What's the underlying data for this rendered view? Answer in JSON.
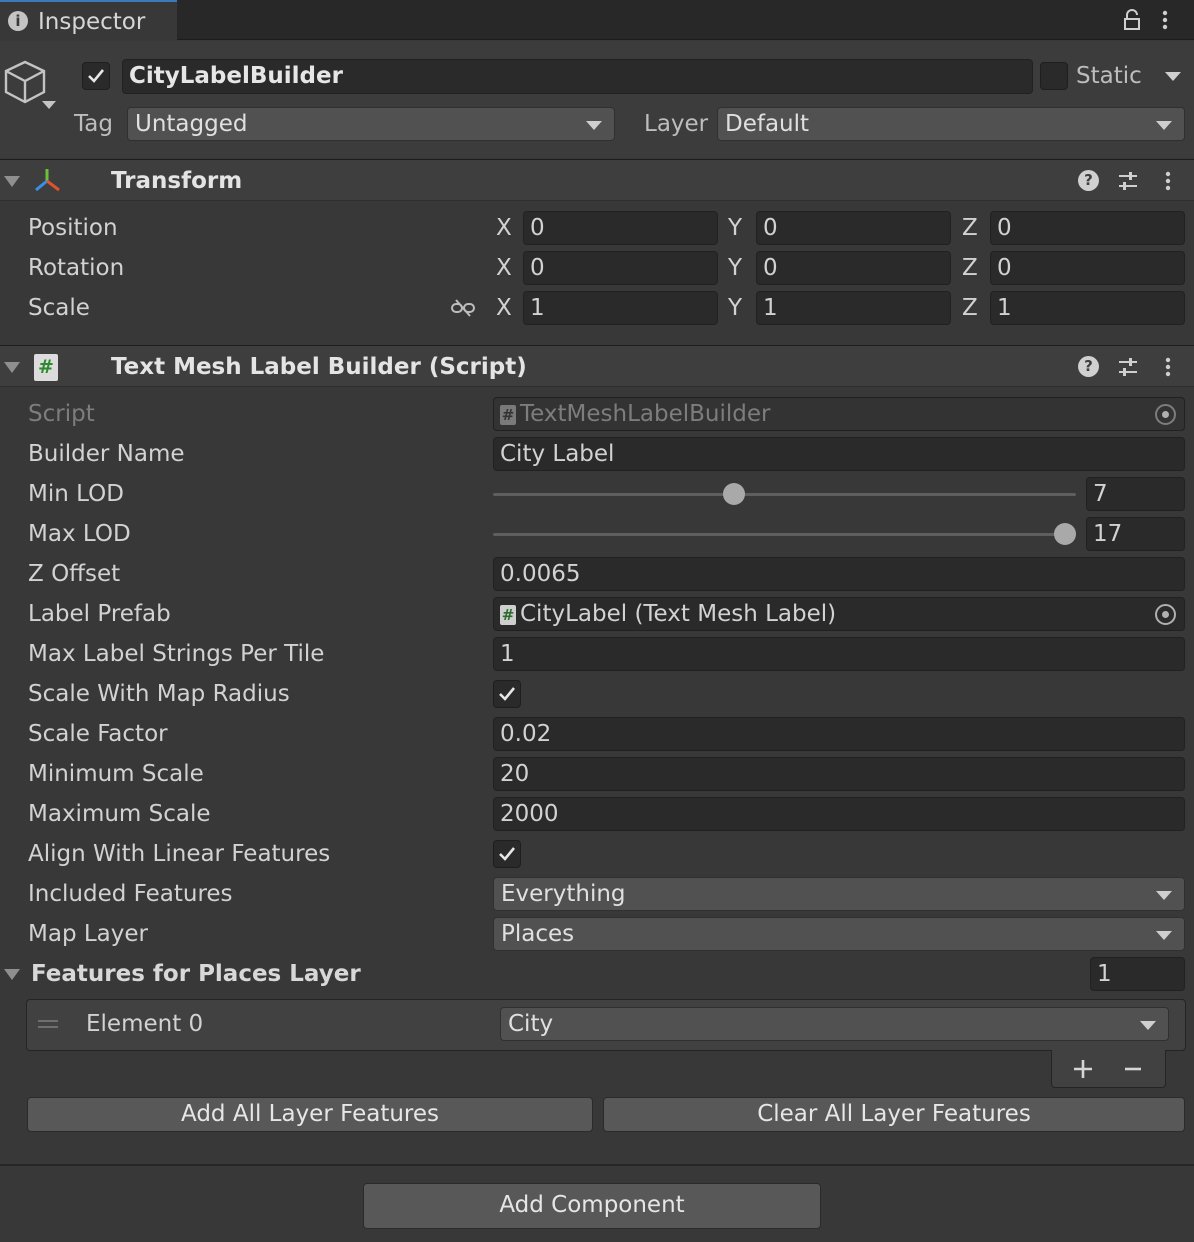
{
  "tab": {
    "title": "Inspector"
  },
  "object": {
    "active": true,
    "name": "CityLabelBuilder",
    "static_label": "Static",
    "tag_label": "Tag",
    "tag_value": "Untagged",
    "layer_label": "Layer",
    "layer_value": "Default"
  },
  "transform": {
    "title": "Transform",
    "rows": [
      {
        "label": "Position",
        "x": "0",
        "y": "0",
        "z": "0"
      },
      {
        "label": "Rotation",
        "x": "0",
        "y": "0",
        "z": "0"
      },
      {
        "label": "Scale",
        "x": "1",
        "y": "1",
        "z": "1"
      }
    ],
    "axis_x": "X",
    "axis_y": "Y",
    "axis_z": "Z"
  },
  "script": {
    "title": "Text Mesh Label Builder (Script)",
    "script_label": "Script",
    "script_value": "TextMeshLabelBuilder",
    "builder_name_label": "Builder Name",
    "builder_name": "City Label",
    "min_lod_label": "Min LOD",
    "min_lod": "7",
    "min_lod_fraction": 0.41,
    "max_lod_label": "Max LOD",
    "max_lod": "17",
    "max_lod_fraction": 1.0,
    "z_offset_label": "Z Offset",
    "z_offset": "0.0065",
    "label_prefab_label": "Label Prefab",
    "label_prefab": "CityLabel (Text Mesh Label)",
    "max_strings_label": "Max Label Strings Per Tile",
    "max_strings": "1",
    "scale_radius_label": "Scale With Map Radius",
    "scale_radius": true,
    "scale_factor_label": "Scale Factor",
    "scale_factor": "0.02",
    "min_scale_label": "Minimum Scale",
    "min_scale": "20",
    "max_scale_label": "Maximum Scale",
    "max_scale": "2000",
    "align_label": "Align With Linear Features",
    "align": true,
    "included_label": "Included Features",
    "included": "Everything",
    "map_layer_label": "Map Layer",
    "map_layer": "Places",
    "features_label": "Features for Places Layer",
    "features_count": "1",
    "element0_label": "Element 0",
    "element0": "City",
    "add_all": "Add All Layer Features",
    "clear_all": "Clear All Layer Features"
  },
  "add_component": "Add Component",
  "colors": {
    "background": "#383838",
    "field": "#2a2a2a",
    "dropdown": "#515151",
    "tab_accent": "#3a79bb"
  }
}
